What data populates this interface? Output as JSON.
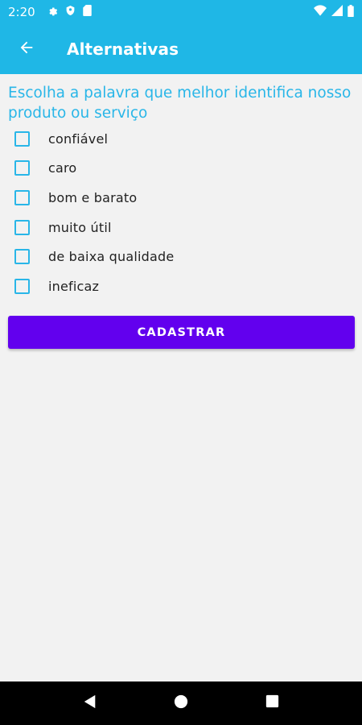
{
  "status_bar": {
    "time": "2:20",
    "icons": [
      "gear-icon",
      "shield-icon",
      "sd-card-icon",
      "wifi-icon",
      "signal-icon",
      "battery-icon"
    ]
  },
  "app_bar": {
    "back_icon": "arrow-left-icon",
    "title": "Alternativas"
  },
  "question": "Escolha a palavra que melhor identifica nosso produto ou serviço",
  "options": [
    {
      "label": "confiável",
      "checked": false
    },
    {
      "label": "caro",
      "checked": false
    },
    {
      "label": "bom e barato",
      "checked": false
    },
    {
      "label": "muito útil",
      "checked": false
    },
    {
      "label": "de baixa qualidade",
      "checked": false
    },
    {
      "label": "ineficaz",
      "checked": false
    }
  ],
  "submit_label": "CADASTRAR",
  "nav_bar": {
    "icons": [
      "back-triangle-icon",
      "home-circle-icon",
      "recents-square-icon"
    ]
  },
  "colors": {
    "primary": "#1fb7e6",
    "accent_text": "#29b6e8",
    "button": "#6200ee",
    "background": "#f2f2f2"
  }
}
